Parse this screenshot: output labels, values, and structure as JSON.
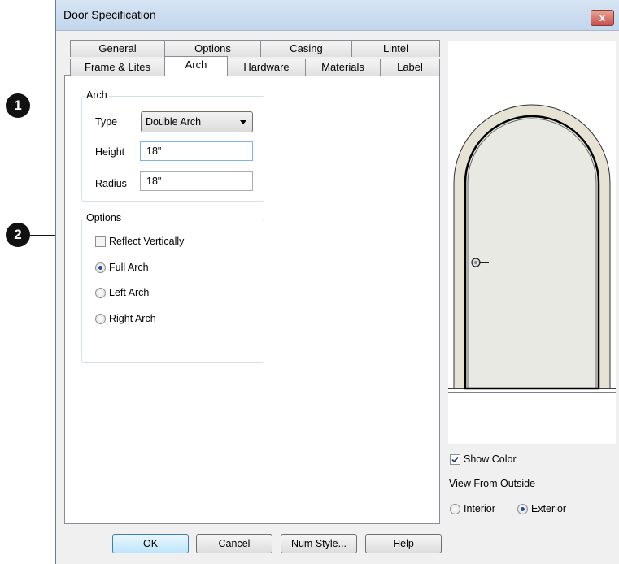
{
  "window": {
    "title": "Door Specification",
    "close_label": "x"
  },
  "callouts": [
    "1",
    "2"
  ],
  "tabs": {
    "row1": [
      "General",
      "Options",
      "Casing",
      "Lintel"
    ],
    "row2": [
      "Frame & Lites",
      "Arch",
      "Hardware",
      "Materials",
      "Label"
    ],
    "active": "Arch"
  },
  "arch_group": {
    "title": "Arch",
    "type_label": "Type",
    "type_value": "Double Arch",
    "height_label": "Height",
    "height_value": "18\"",
    "radius_label": "Radius",
    "radius_value": "18\""
  },
  "options_group": {
    "title": "Options",
    "reflect_label": "Reflect Vertically",
    "reflect_checked": false,
    "radios": [
      {
        "label": "Full Arch",
        "selected": true
      },
      {
        "label": "Left Arch",
        "selected": false
      },
      {
        "label": "Right Arch",
        "selected": false
      }
    ]
  },
  "preview": {
    "show_color_label": "Show Color",
    "show_color_checked": true,
    "view_from_label": "View From Outside",
    "interior_label": "Interior",
    "exterior_label": "Exterior",
    "selected_view": "Exterior",
    "door_color": "#e8e9e3",
    "casing_color": "#e6e2d4"
  },
  "buttons": {
    "ok": "OK",
    "cancel": "Cancel",
    "num_style": "Num Style...",
    "help": "Help"
  }
}
